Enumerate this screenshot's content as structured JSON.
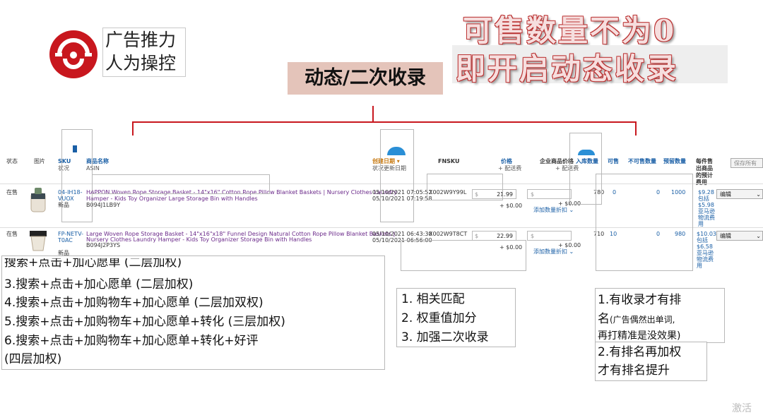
{
  "logo": {
    "line1": "广告推力",
    "line2": "人为操控"
  },
  "headline": {
    "line1": "可售数量不为0",
    "line2": "即开启动态收录"
  },
  "dynamic_label": "动态/二次收录",
  "table": {
    "headers": {
      "status": "状态",
      "image": "图片",
      "sku": "SKU",
      "sku_sub": "状况",
      "product_name": "商品名称",
      "product_sub": "ASIN",
      "date": "创建日期 ▾",
      "date_sub": "状况更新日期",
      "fnsku": "FNSKU",
      "price": "价格",
      "price_sub": "+ 配送费",
      "biz_price": "企业商品价格",
      "biz_price_sub": "+ 配送费",
      "inbound": "入库数量",
      "available": "可售",
      "unsellable": "不可售数量",
      "reserved": "预留数量",
      "fee": "每件售出商品的预计费用",
      "save_all": "保存所有"
    },
    "rows": [
      {
        "status": "在售",
        "sku": "04-IH18-VUOX",
        "condition": "新品",
        "title_line1": "HAPPON Woven Rope Storage Basket - 14\"x16\" Cotton Rope Pillow Blanket Baskets | Nursery Clothes Laundry",
        "title_line2": "Hamper - Kids Toy Organizer Large Storage Bin with Handles",
        "asin": "B094J1LB9Y",
        "created": "05/10/2021 07:05:52",
        "updated": "05/10/2021 07:19:58",
        "fnsku": "X002W9Y99L",
        "price": "21.99",
        "shipping": "+ $0.00",
        "biz_shipping": "+ $0.00",
        "add_qty_discount": "添加数量折扣 ⌄",
        "inbound": "780",
        "available": "0",
        "unsellable": "0",
        "reserved": "1000",
        "fee_lines": [
          "$9.28",
          "包括",
          "$5.98",
          "亚马逊",
          "物流费",
          "用"
        ],
        "edit": "编辑"
      },
      {
        "status": "在售",
        "sku": "FP-NETV-T0AC",
        "condition": "新品",
        "title_line1": "Large Woven Rope Storage Basket - 14\"x16\"x18\" Funnel Design Natural Cotton Rope Pillow Blanket Baskets |",
        "title_line2": "Nursery Clothes Laundry Hamper - Kids Toy Organizer Storage Bin with Handles",
        "asin": "B094J2P3YS",
        "created": "05/10/2021 06:43:30",
        "updated": "05/10/2021 06:56:00",
        "fnsku": "X002W9T8CT",
        "price": "22.99",
        "shipping": "+ $0.00",
        "biz_shipping": "+ $0.00",
        "add_qty_discount": "添加数量折扣 ⌄",
        "inbound": "710",
        "available": "10",
        "unsellable": "0",
        "reserved": "980",
        "fee_lines": [
          "$10.03",
          "包括",
          "$6.58",
          "亚马逊",
          "物流费",
          "用"
        ],
        "edit": "编辑"
      }
    ],
    "currency": "$"
  },
  "left_notes": {
    "cut": "搜索+点击+加心愿单 (二层加权)",
    "l3": "3.搜索+点击+加心愿单  (二层加权)",
    "l4": "4.搜索+点击+加购物车+加心愿单  (二层加双权)",
    "l5": "5.搜索+点击+加购物车+加心愿单+转化  (三层加权)",
    "l6": "6.搜索+点击+加购物车+加心愿单+转化+好评",
    "l6b": " (四层加权)"
  },
  "mid_notes": {
    "n1": "1. 相关匹配",
    "n2": "2. 权重值加分",
    "n3": "3. 加强二次收录"
  },
  "right_notes": {
    "r1": "1.有收录才有排",
    "r2": "名",
    "r2_small": "(广告偶然出单词,",
    "r3": "再打精准是没效果)",
    "r4": "2.有排名再加权",
    "r5": "才有排名提升"
  },
  "watermark": "激活"
}
